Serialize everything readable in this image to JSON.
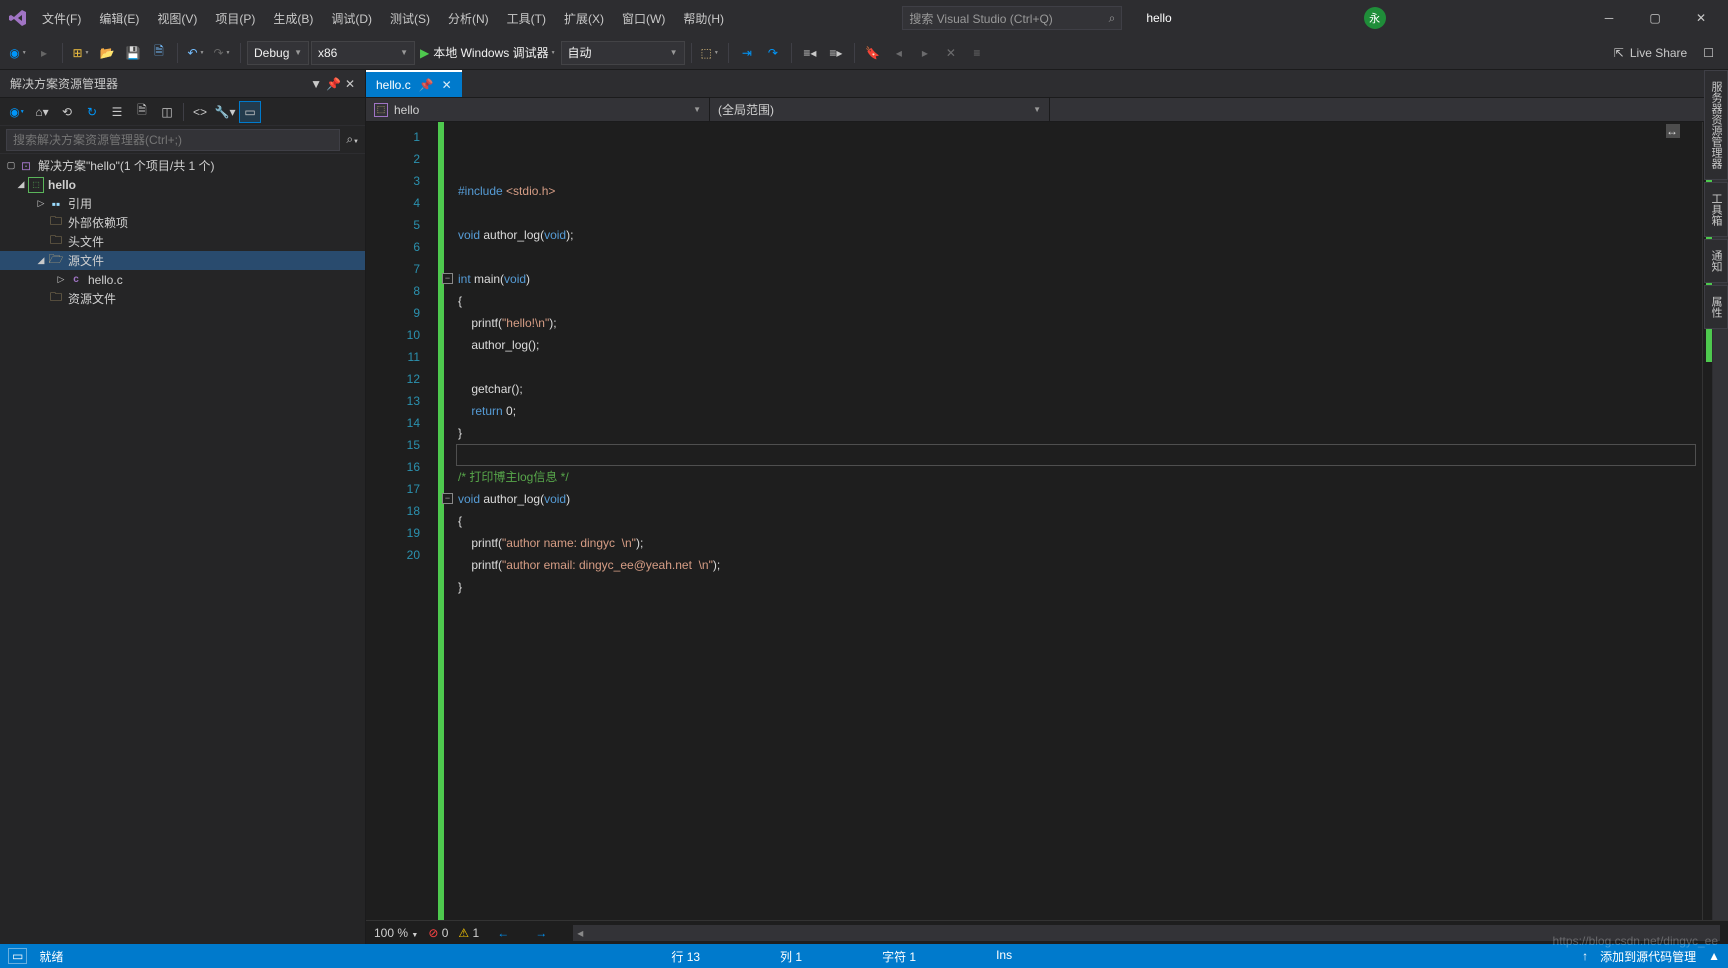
{
  "menu": [
    "文件(F)",
    "编辑(E)",
    "视图(V)",
    "项目(P)",
    "生成(B)",
    "调试(D)",
    "测试(S)",
    "分析(N)",
    "工具(T)",
    "扩展(X)",
    "窗口(W)",
    "帮助(H)"
  ],
  "search": {
    "placeholder": "搜索 Visual Studio (Ctrl+Q)"
  },
  "project": {
    "name": "hello"
  },
  "avatar": {
    "initial": "永"
  },
  "toolbar": {
    "config": "Debug",
    "platform": "x86",
    "runLabel": "本地 Windows 调试器",
    "autoLabel": "自动",
    "liveShare": "Live Share"
  },
  "sidePanel": {
    "title": "解决方案资源管理器",
    "searchPlaceholder": "搜索解决方案资源管理器(Ctrl+;)",
    "solution": "解决方案\"hello\"(1 个项目/共 1 个)",
    "projName": "hello",
    "nodes": {
      "refs": "引用",
      "extDeps": "外部依赖项",
      "headers": "头文件",
      "sources": "源文件",
      "helloC": "hello.c",
      "resources": "资源文件"
    }
  },
  "tabs": {
    "active": "hello.c"
  },
  "navbar": {
    "proj": "hello",
    "scope": "(全局范围)"
  },
  "code": {
    "lines": [
      {
        "n": 1,
        "html": "<span class='kw'>#include</span> <span class='ang'>&lt;stdio.h&gt;</span>"
      },
      {
        "n": 2,
        "html": ""
      },
      {
        "n": 3,
        "html": "<span class='kw'>void</span> author_log(<span class='kw'>void</span>);"
      },
      {
        "n": 4,
        "html": ""
      },
      {
        "n": 5,
        "html": "<span class='kw'>int</span> main(<span class='kw'>void</span>)",
        "fold": true
      },
      {
        "n": 6,
        "html": "{"
      },
      {
        "n": 7,
        "html": "    printf(<span class='str'>\"hello!\\n\"</span>);"
      },
      {
        "n": 8,
        "html": "    author_log();"
      },
      {
        "n": 9,
        "html": ""
      },
      {
        "n": 10,
        "html": "    getchar();"
      },
      {
        "n": 11,
        "html": "    <span class='kw'>return</span> 0;"
      },
      {
        "n": 12,
        "html": "}"
      },
      {
        "n": 13,
        "html": "",
        "cursor": true
      },
      {
        "n": 14,
        "html": "<span class='com'>/* 打印博主log信息 */</span>"
      },
      {
        "n": 15,
        "html": "<span class='kw'>void</span> author_log(<span class='kw'>void</span>)",
        "fold": true
      },
      {
        "n": 16,
        "html": "{"
      },
      {
        "n": 17,
        "html": "    printf(<span class='str'>\"author name: dingyc  \\n\"</span>);"
      },
      {
        "n": 18,
        "html": "    printf(<span class='str'>\"author email: dingyc_ee@yeah.net  \\n\"</span>);"
      },
      {
        "n": 19,
        "html": "}"
      },
      {
        "n": 20,
        "html": ""
      }
    ]
  },
  "editorFooter": {
    "zoom": "100 %",
    "errors": "0",
    "warnings": "1"
  },
  "status": {
    "ready": "就绪",
    "line": "行 13",
    "col": "列 1",
    "char": "字符 1",
    "ins": "Ins",
    "addSrc": "添加到源代码管理"
  },
  "rightTabs": [
    "服务器资源管理器",
    "工具箱",
    "通知",
    "属性"
  ],
  "watermark": "https://blog.csdn.net/dingyc_ee"
}
